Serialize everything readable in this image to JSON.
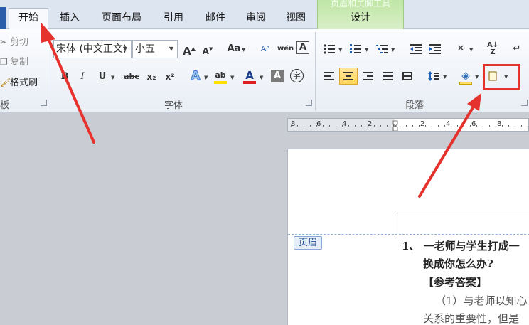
{
  "tabs": [
    {
      "label": "开始",
      "active": true
    },
    {
      "label": "插入"
    },
    {
      "label": "页面布局"
    },
    {
      "label": "引用"
    },
    {
      "label": "邮件"
    },
    {
      "label": "审阅"
    },
    {
      "label": "视图"
    },
    {
      "label": "设计"
    }
  ],
  "contextual_group_label": "页眉和页脚工具",
  "clipboard": {
    "cut": "剪切",
    "copy": "复制",
    "format_painter": "格式刷",
    "group_label": "板"
  },
  "font": {
    "name": "宋体 (中文正文)",
    "size": "小五",
    "group_label": "字体",
    "grow": "A",
    "shrink": "A",
    "case": "Aa",
    "bold": "B",
    "italic": "I",
    "underline": "U",
    "strike": "abc",
    "subscript": "x₂",
    "superscript": "x²",
    "effects": "A",
    "highlight": "ab",
    "color": "A",
    "shading": "A",
    "enclose": "字"
  },
  "paragraph": {
    "group_label": "段落"
  },
  "ruler_labels": [
    "8",
    "6",
    "4",
    "2",
    "2",
    "4",
    "6",
    "8"
  ],
  "document": {
    "header_badge": "页眉",
    "lines": [
      "1、  一老师与学生打成一",
      "换成你怎么办?",
      "【参考答案】",
      "（1）与老师以知心",
      "关系的重要性，但是"
    ]
  },
  "colors": {
    "accent_red": "#e5322d",
    "tab_bar": "#dde5f0",
    "context_green": "#bfe6a6",
    "highlight_yellow": "#ffe066",
    "font_color_red": "#e02020"
  }
}
